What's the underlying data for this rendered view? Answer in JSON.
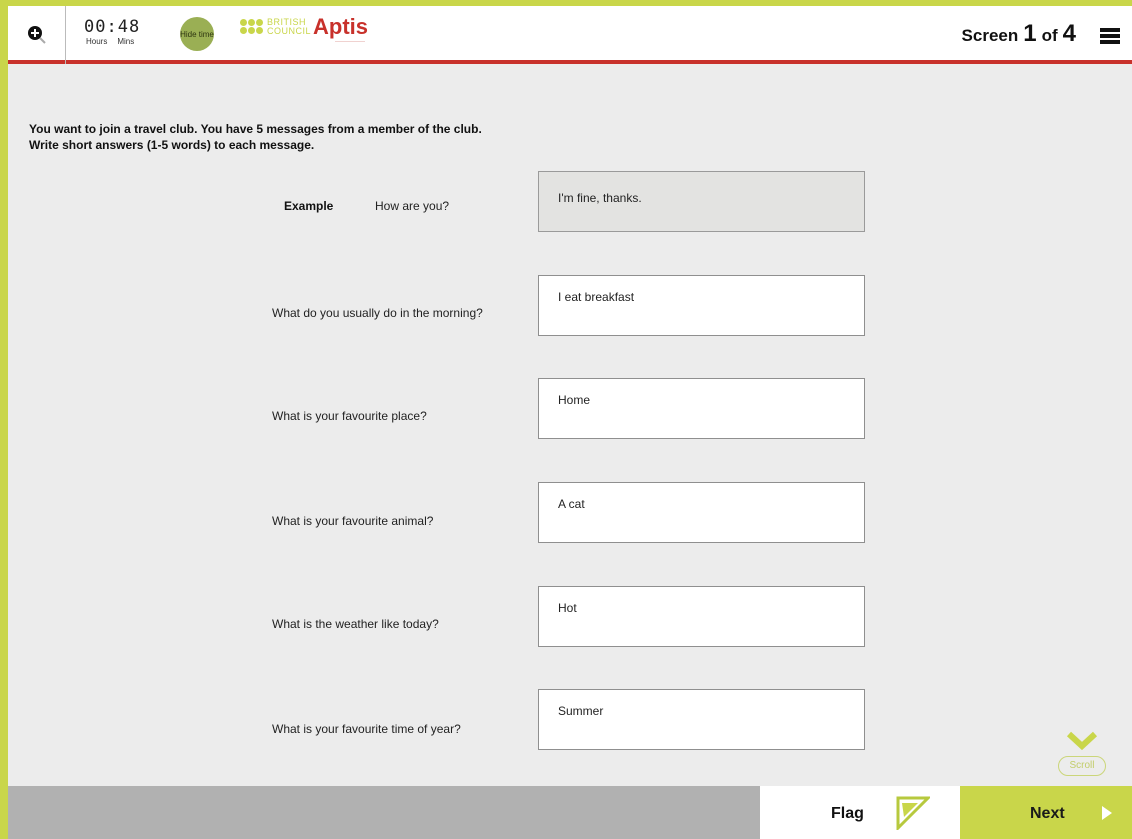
{
  "header": {
    "timer": {
      "value": "00:48",
      "hours_label": "Hours",
      "mins_label": "Mins"
    },
    "hide_time_label": "Hide time",
    "logo": {
      "british_council": "BRITISH COUNCIL",
      "aptis": "Aptis"
    },
    "screen": {
      "prefix": "Screen",
      "current": "1",
      "separator": "of",
      "total": "4"
    }
  },
  "instructions": {
    "line1": "You want to join a travel club. You have 5 messages from a member of the club.",
    "line2": "Write short answers (1-5 words) to each message."
  },
  "example": {
    "label": "Example",
    "question": "How are you?",
    "answer": "I'm fine, thanks."
  },
  "questions": [
    {
      "question": "What do you usually do in the morning?",
      "answer": "I eat breakfast"
    },
    {
      "question": "What is your favourite place?",
      "answer": "Home"
    },
    {
      "question": "What is your favourite animal?",
      "answer": "A cat"
    },
    {
      "question": "What is the weather like today?",
      "answer": "Hot"
    },
    {
      "question": "What is your favourite time of year?",
      "answer": "Summer"
    }
  ],
  "scroll_label": "Scroll",
  "footer": {
    "flag_label": "Flag",
    "next_label": "Next"
  },
  "colors": {
    "accent_green": "#c9d64a",
    "brand_red": "#c8312b",
    "background": "#ececec"
  },
  "icons": [
    "zoom-in-icon",
    "question-grid-icon",
    "scroll-chevron-icon",
    "flag-icon",
    "next-arrow-icon"
  ]
}
